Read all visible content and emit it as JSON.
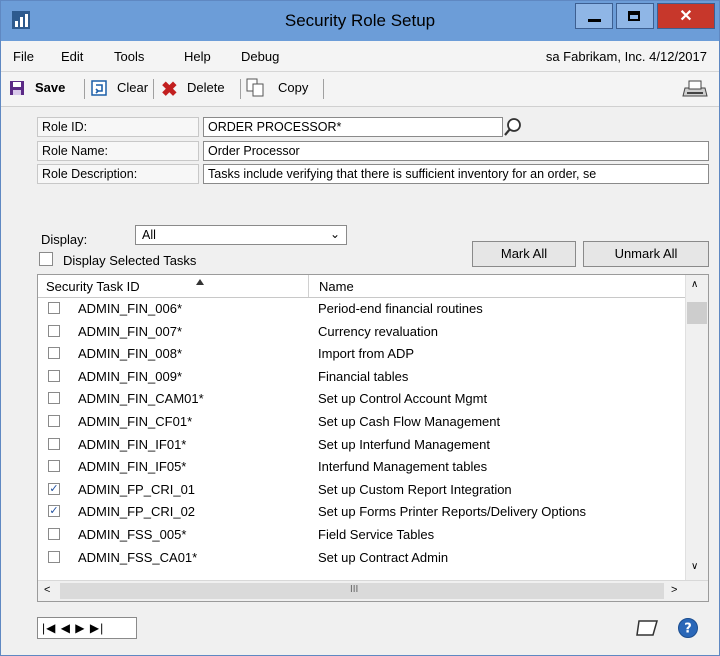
{
  "window": {
    "title": "Security Role Setup"
  },
  "menu": {
    "items": [
      "File",
      "Edit",
      "Tools",
      "Help",
      "Debug"
    ],
    "session_info": "sa  Fabrikam, Inc. 4/12/2017"
  },
  "toolbar": {
    "save_label": "Save",
    "clear_label": "Clear",
    "delete_label": "Delete",
    "copy_label": "Copy"
  },
  "form": {
    "role_id_label": "Role ID:",
    "role_id_value": "ORDER PROCESSOR*",
    "role_name_label": "Role Name:",
    "role_name_value": "Order Processor",
    "role_description_label": "Role Description:",
    "role_description_value": "Tasks include verifying that there is sufficient inventory for an order, se"
  },
  "filter": {
    "display_label": "Display:",
    "display_value": "All",
    "display_selected_label": "Display Selected Tasks",
    "mark_all_label": "Mark All",
    "unmark_all_label": "Unmark All"
  },
  "grid": {
    "columns": [
      "Security Task ID",
      "Name"
    ],
    "rows": [
      {
        "id": "ADMIN_FIN_006*",
        "name": "Period-end financial routines",
        "checked": false
      },
      {
        "id": "ADMIN_FIN_007*",
        "name": "Currency revaluation",
        "checked": false
      },
      {
        "id": "ADMIN_FIN_008*",
        "name": "Import from ADP",
        "checked": false
      },
      {
        "id": "ADMIN_FIN_009*",
        "name": "Financial tables",
        "checked": false
      },
      {
        "id": "ADMIN_FIN_CAM01*",
        "name": "Set up Control Account Mgmt",
        "checked": false
      },
      {
        "id": "ADMIN_FIN_CF01*",
        "name": "Set up Cash Flow Management",
        "checked": false
      },
      {
        "id": "ADMIN_FIN_IF01*",
        "name": "Set up Interfund Management",
        "checked": false
      },
      {
        "id": "ADMIN_FIN_IF05*",
        "name": "Interfund Management tables",
        "checked": false
      },
      {
        "id": "ADMIN_FP_CRI_01",
        "name": "Set up Custom Report Integration",
        "checked": true
      },
      {
        "id": "ADMIN_FP_CRI_02",
        "name": "Set up Forms Printer Reports/Delivery Options",
        "checked": true
      },
      {
        "id": "ADMIN_FSS_005*",
        "name": "Field Service Tables",
        "checked": false
      },
      {
        "id": "ADMIN_FSS_CA01*",
        "name": "Set up Contract Admin",
        "checked": false
      }
    ]
  },
  "colors": {
    "titlebar": "#6c9dd8",
    "close": "#c7372b",
    "delete_x": "#c21f1f",
    "save_icon": "#5b2a86"
  }
}
